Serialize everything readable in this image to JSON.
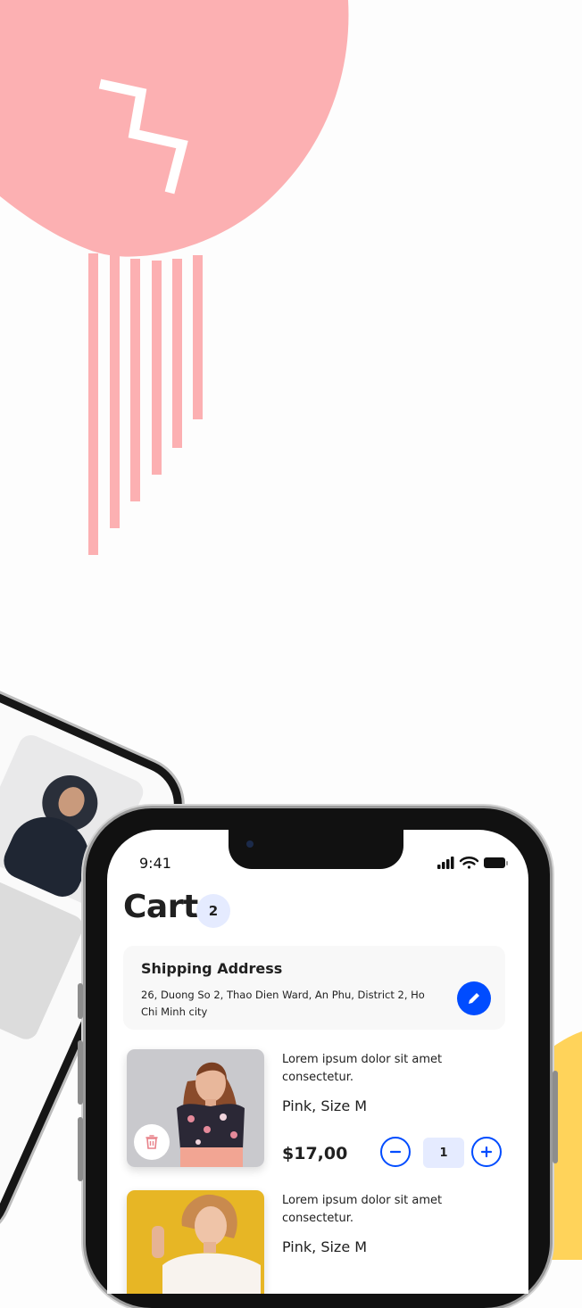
{
  "status_bar": {
    "time": "9:41"
  },
  "cart": {
    "title": "Cart",
    "count": "2"
  },
  "shipping": {
    "title": "Shipping Address",
    "address": "26, Duong So 2, Thao Dien Ward, An Phu, District 2, Ho Chi Minh city"
  },
  "items": [
    {
      "description": "Lorem ipsum dolor sit amet consectetur.",
      "variant": "Pink, Size M",
      "price": "$17,00",
      "quantity": "1"
    },
    {
      "description": "Lorem ipsum dolor sit amet consectetur.",
      "variant": "Pink, Size M"
    }
  ],
  "icons": {
    "edit": "pencil-icon",
    "delete": "trash-icon",
    "minus": "minus-icon",
    "plus": "plus-icon",
    "signal": "signal-icon",
    "wifi": "wifi-icon",
    "battery": "battery-icon"
  },
  "colors": {
    "accent": "#004cff",
    "badge_bg": "#e5ebff",
    "blob": "#fcb0b2",
    "yellow": "#ffd35a"
  }
}
